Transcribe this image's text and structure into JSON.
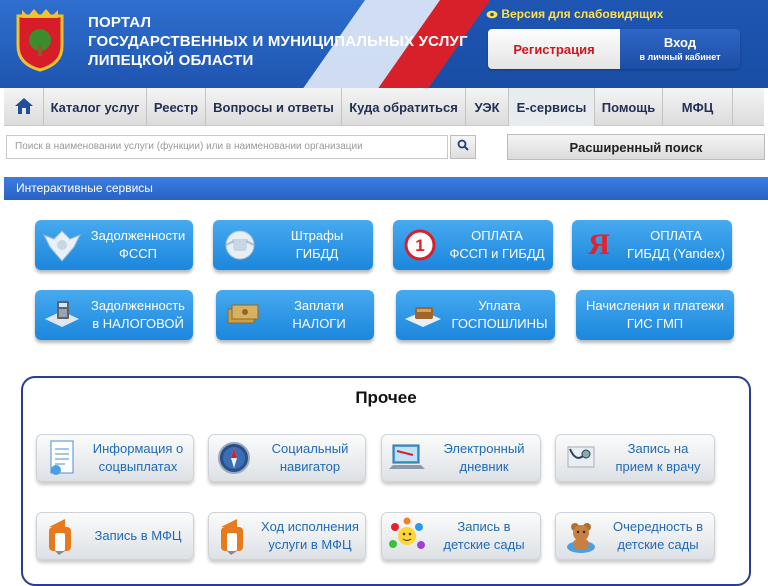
{
  "header": {
    "title_line1": "ПОРТАЛ",
    "title_line2": "ГОСУДАРСТВЕННЫХ И МУНИЦИПАЛЬНЫХ УСЛУГ",
    "title_line3": "ЛИПЕЦКОЙ ОБЛАСТИ",
    "accessibility_link": "Версия для слабовидящих",
    "register_label": "Регистрация",
    "login_label": "Вход",
    "login_sublabel": "в личный кабинет"
  },
  "nav": {
    "items": [
      "Каталог услуг",
      "Реестр",
      "Вопросы и ответы",
      "Куда обратиться",
      "УЭК",
      "Е-сервисы",
      "Помощь",
      "МФЦ"
    ]
  },
  "search": {
    "placeholder": "Поиск в наименовании услуги (функции) или в наименовании организации",
    "advanced_label": "Расширенный поиск"
  },
  "section": {
    "title": "Интерактивные сервисы"
  },
  "services": [
    {
      "line1": "Задолженности",
      "line2": "ФССП",
      "icon": "fssp-emblem-icon"
    },
    {
      "line1": "Штрафы",
      "line2": "ГИБДД",
      "icon": "gibdd-emblem-icon"
    },
    {
      "line1": "ОПЛАТА",
      "line2": "ФССП и ГИБДД",
      "icon": "payment-one-icon"
    },
    {
      "line1": "ОПЛАТА",
      "line2": "ГИБДД (Yandex)",
      "icon": "yandex-icon"
    },
    {
      "line1": "Задолженность",
      "line2": "в НАЛОГОВОЙ",
      "icon": "calculator-icon"
    },
    {
      "line1": "Заплати",
      "line2": "НАЛОГИ",
      "icon": "money-icon"
    },
    {
      "line1": "Уплата",
      "line2": "ГОСПОШЛИНЫ",
      "icon": "wallet-icon"
    },
    {
      "line1": "Начисления и платежи",
      "line2": "ГИС ГМП",
      "icon": ""
    }
  ],
  "other": {
    "title": "Прочее",
    "items": [
      {
        "line1": "Информация о",
        "line2": "соцвыплатах",
        "icon": "document-icon"
      },
      {
        "line1": "Социальный",
        "line2": "навигатор",
        "icon": "compass-icon"
      },
      {
        "line1": "Электронный",
        "line2": "дневник",
        "icon": "diary-icon"
      },
      {
        "line1": "Запись на",
        "line2": "прием к врачу",
        "icon": "stethoscope-icon"
      },
      {
        "line1": "Запись в МФЦ",
        "line2": "",
        "icon": "mfc-logo-icon"
      },
      {
        "line1": "Ход исполнения",
        "line2": "услуги в МФЦ",
        "icon": "mfc-logo-icon"
      },
      {
        "line1": "Запись в",
        "line2": "детские сады",
        "icon": "kids-smile-icon"
      },
      {
        "line1": "Очередность в",
        "line2": "детские сады",
        "icon": "teddy-bear-icon"
      }
    ]
  },
  "colors": {
    "header_blue": "#1e55b0",
    "accent_red": "#d8202a",
    "button_blue": "#1b86dc",
    "link_yellow": "#ffe14a"
  }
}
